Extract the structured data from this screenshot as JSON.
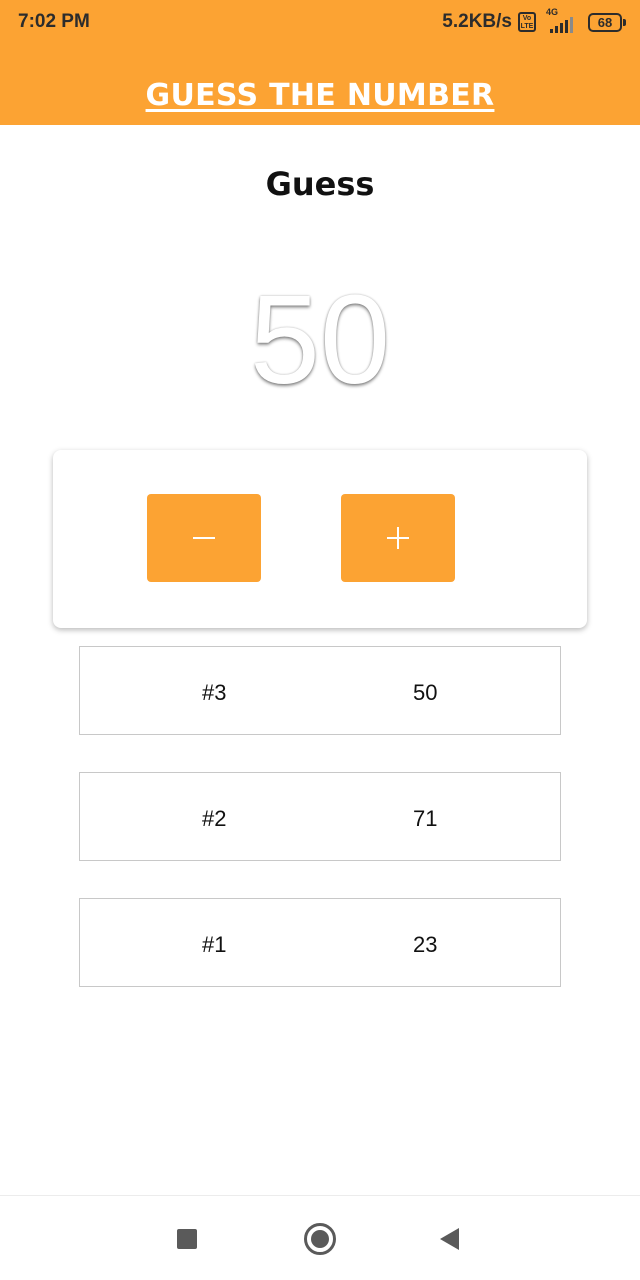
{
  "status_bar": {
    "time": "7:02 PM",
    "net_speed": "5.2KB/s",
    "volte_top": "Vo",
    "volte_bottom": "LTE",
    "network_type": "4G",
    "battery": "68"
  },
  "header": {
    "title": "GUESS THE NUMBER",
    "background_color": "#fca333"
  },
  "guess": {
    "label": "Guess",
    "current_value": "50"
  },
  "controls": {
    "decrement_icon": "minus-icon",
    "increment_icon": "plus-icon",
    "button_color": "#fca333"
  },
  "history": [
    {
      "index": "#3",
      "value": "50"
    },
    {
      "index": "#2",
      "value": "71"
    },
    {
      "index": "#1",
      "value": "23"
    }
  ],
  "navbar": {
    "icons": [
      "recents-square-icon",
      "home-circle-icon",
      "back-triangle-icon"
    ]
  }
}
